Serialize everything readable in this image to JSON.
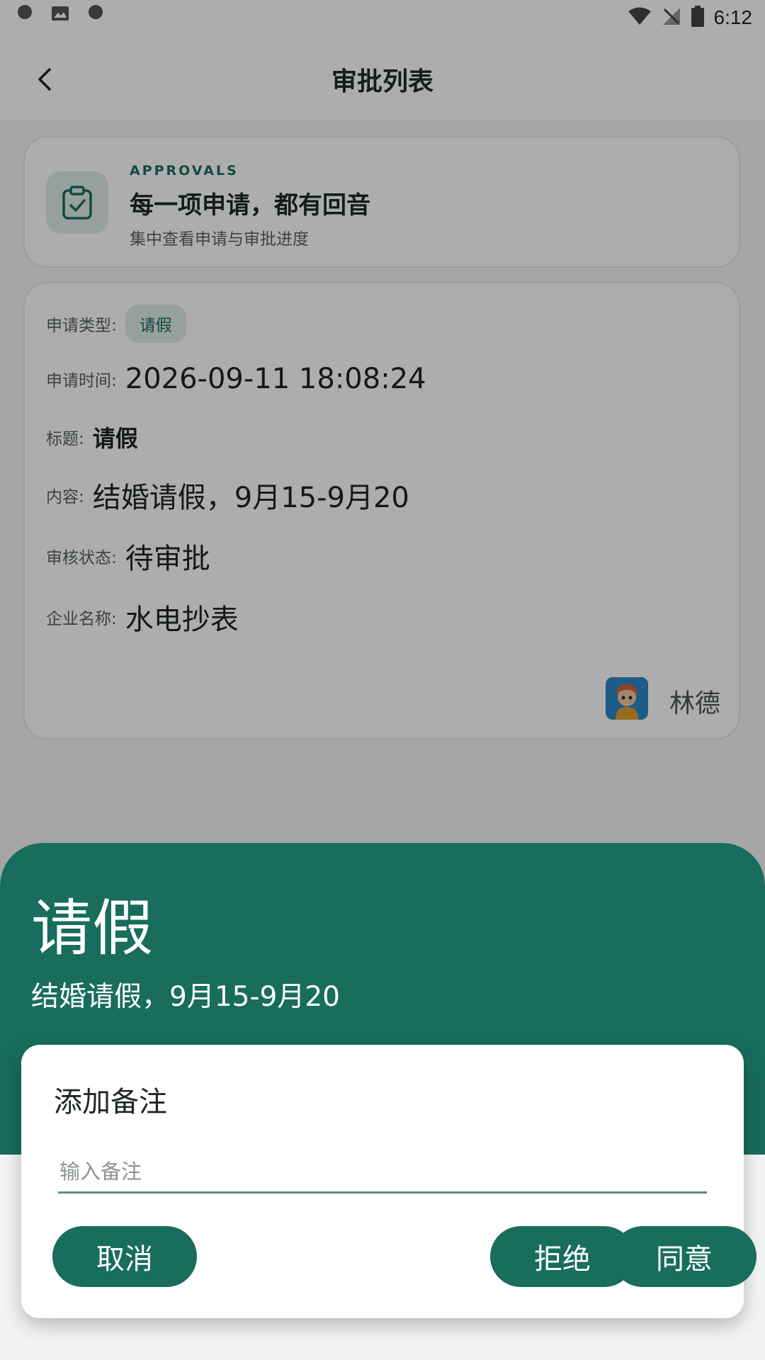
{
  "status_bar": {
    "time": "6:12",
    "left_icons": [
      "app-logo-icon",
      "image-icon",
      "app-logo-icon"
    ],
    "right_icons": [
      "wifi-icon",
      "no-signal-icon",
      "battery-icon"
    ]
  },
  "header": {
    "title": "审批列表",
    "back_icon": "chevron-left-icon"
  },
  "banner": {
    "eyebrow": "APPROVALS",
    "heading": "每一项申请，都有回音",
    "subtext": "集中查看申请与审批进度",
    "icon": "clipboard-check-icon"
  },
  "detail": {
    "type_label": "申请类型:",
    "type_value": "请假",
    "time_label": "申请时间:",
    "time_value": "2026-09-11 18:08:24",
    "title_label": "标题:",
    "title_value": "请假",
    "content_label": "内容:",
    "content_value": "结婚请假，9月15-9月20",
    "status_label": "审核状态:",
    "status_value": "待审批",
    "company_label": "企业名称:",
    "company_value": "水电抄表",
    "applicant_name": "林德"
  },
  "sheet": {
    "title": "请假",
    "content": "结婚请假，9月15-9月20"
  },
  "dialog": {
    "title": "添加备注",
    "input_placeholder": "输入备注",
    "input_value": "",
    "cancel_label": "取消",
    "reject_label": "拒绝",
    "agree_label": "同意"
  },
  "colors": {
    "primary": "#186d5d",
    "chip_bg": "#dfece7",
    "overlay": "rgba(0,0,0,0.32)"
  }
}
